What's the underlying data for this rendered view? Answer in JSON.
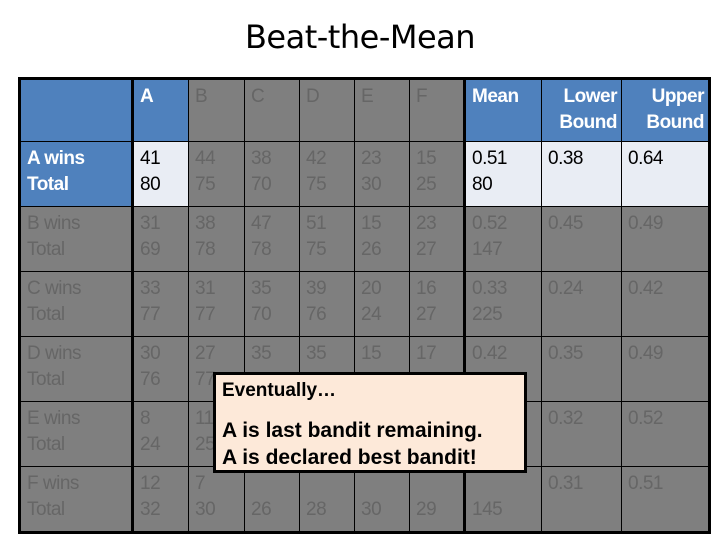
{
  "title": "Beat-the-Mean",
  "colors": {
    "header_blue": "#4f81bd",
    "active_light": "#e9edf4",
    "eliminated_gray": "#7f7f7f",
    "callout_bg": "#fde9d9"
  },
  "table": {
    "headers": [
      "",
      "A",
      "B",
      "C",
      "D",
      "E",
      "F",
      "Mean",
      "Lower|Bound",
      "Upper|Bound"
    ],
    "rows": [
      {
        "label": [
          "A wins",
          "Total"
        ],
        "cells": [
          [
            "41",
            "80"
          ],
          [
            "44",
            "75"
          ],
          [
            "38",
            "70"
          ],
          [
            "42",
            "75"
          ],
          [
            "23",
            "30"
          ],
          [
            "15",
            "25"
          ]
        ],
        "mean": [
          "0.51",
          "80"
        ],
        "lower": "0.38",
        "upper": "0.64"
      },
      {
        "label": [
          "B wins",
          "Total"
        ],
        "cells": [
          [
            "31",
            "69"
          ],
          [
            "38",
            "78"
          ],
          [
            "47",
            "78"
          ],
          [
            "51",
            "75"
          ],
          [
            "15",
            "26"
          ],
          [
            "23",
            "27"
          ]
        ],
        "mean": [
          "0.52",
          "147"
        ],
        "lower": "0.45",
        "upper": "0.49"
      },
      {
        "label": [
          "C wins",
          "Total"
        ],
        "cells": [
          [
            "33",
            "77"
          ],
          [
            "31",
            "77"
          ],
          [
            "35",
            "70"
          ],
          [
            "39",
            "76"
          ],
          [
            "20",
            "24"
          ],
          [
            "16",
            "27"
          ]
        ],
        "mean": [
          "0.33",
          "225"
        ],
        "lower": "0.24",
        "upper": "0.42"
      },
      {
        "label": [
          "D wins",
          "Total"
        ],
        "cells": [
          [
            "30",
            "76"
          ],
          [
            "27",
            "77"
          ],
          [
            "35",
            ""
          ],
          [
            "35",
            ""
          ],
          [
            "15",
            ""
          ],
          [
            "17",
            ""
          ]
        ],
        "mean": [
          "0.42",
          ""
        ],
        "lower": "0.35",
        "upper": "0.49"
      },
      {
        "label": [
          "E wins",
          "Total"
        ],
        "cells": [
          [
            "8",
            "24"
          ],
          [
            "11",
            "25"
          ],
          [
            "",
            ""
          ],
          [
            "",
            ""
          ],
          [
            "",
            ""
          ],
          [
            "",
            ""
          ]
        ],
        "mean": [
          "",
          ""
        ],
        "lower": "0.32",
        "upper": "0.52"
      },
      {
        "label": [
          "F wins",
          "Total"
        ],
        "cells": [
          [
            "12",
            "32"
          ],
          [
            "7",
            "30"
          ],
          [
            "",
            "26"
          ],
          [
            "",
            "28"
          ],
          [
            "",
            "30"
          ],
          [
            "",
            "29"
          ]
        ],
        "mean": [
          "",
          "145"
        ],
        "lower": "0.31",
        "upper": "0.51"
      }
    ]
  },
  "callout": {
    "line1": "Eventually…",
    "line2": "A is last bandit remaining.",
    "line3": "A is declared best bandit!"
  }
}
